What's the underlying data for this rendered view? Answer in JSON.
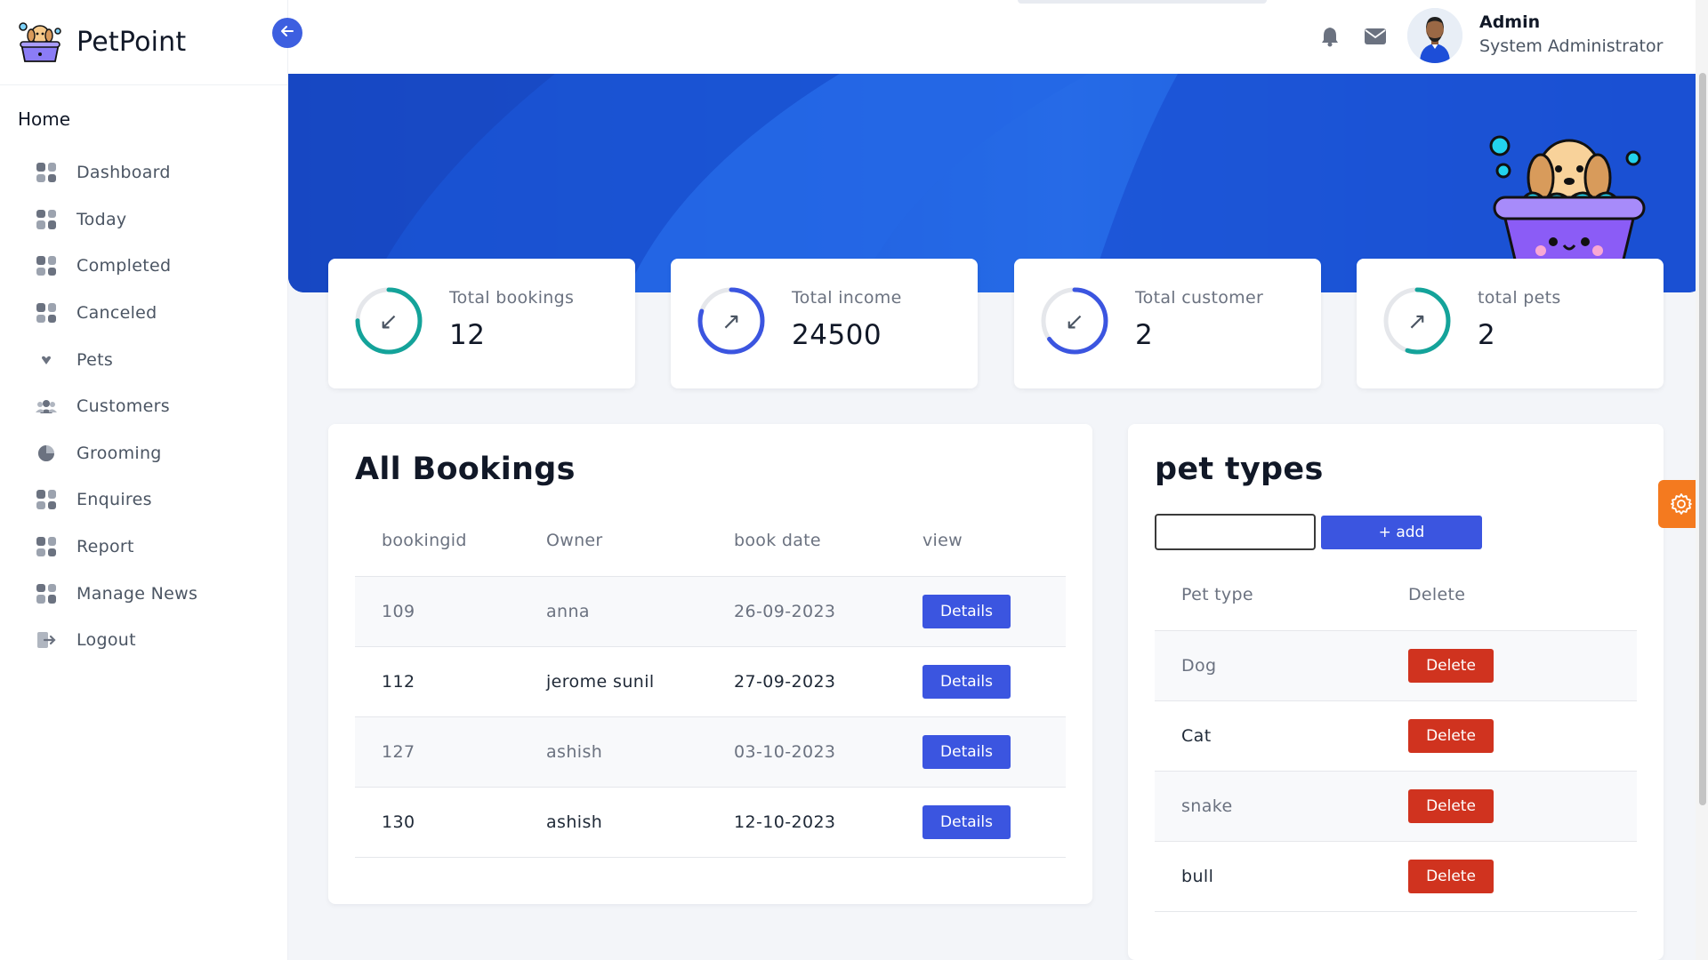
{
  "brand": {
    "name": "PetPoint",
    "logo_icon": "pet-tub-logo-icon"
  },
  "sidebar": {
    "section_title": "Home",
    "items": [
      {
        "label": "Dashboard",
        "icon": "grid-icon"
      },
      {
        "label": "Today",
        "icon": "grid-icon"
      },
      {
        "label": "Completed",
        "icon": "grid-icon"
      },
      {
        "label": "Canceled",
        "icon": "grid-icon"
      },
      {
        "label": "Pets",
        "icon": "heart-icon"
      },
      {
        "label": "Customers",
        "icon": "users-icon"
      },
      {
        "label": "Grooming",
        "icon": "pie-chart-icon"
      },
      {
        "label": "Enquires",
        "icon": "grid-icon"
      },
      {
        "label": "Report",
        "icon": "grid-icon"
      },
      {
        "label": "Manage News",
        "icon": "grid-icon"
      },
      {
        "label": "Logout",
        "icon": "logout-icon"
      }
    ]
  },
  "topbar": {
    "back_icon": "arrow-left-icon",
    "notification_icon": "bell-icon",
    "mail_icon": "mail-icon",
    "user": {
      "name": "Admin",
      "role": "System Administrator"
    }
  },
  "stats": [
    {
      "label": "Total bookings",
      "value": "12",
      "arrow": "↙",
      "ring_color": "#14a39a",
      "ring_fraction": 0.75
    },
    {
      "label": "Total income",
      "value": "24500",
      "arrow": "↗",
      "ring_color": "#3b55e0",
      "ring_fraction": 0.8
    },
    {
      "label": "Total customer",
      "value": "2",
      "arrow": "↙",
      "ring_color": "#3b55e0",
      "ring_fraction": 0.65
    },
    {
      "label": "total pets",
      "value": "2",
      "arrow": "↗",
      "ring_color": "#14a39a",
      "ring_fraction": 0.55
    }
  ],
  "bookings": {
    "title": "All Bookings",
    "columns": [
      "bookingid",
      "Owner",
      "book date",
      "view"
    ],
    "rows": [
      {
        "id": "109",
        "owner": "anna",
        "date": "26-09-2023",
        "action": "Details"
      },
      {
        "id": "112",
        "owner": "jerome sunil",
        "date": "27-09-2023",
        "action": "Details"
      },
      {
        "id": "127",
        "owner": "ashish",
        "date": "03-10-2023",
        "action": "Details"
      },
      {
        "id": "130",
        "owner": "ashish",
        "date": "12-10-2023",
        "action": "Details"
      }
    ]
  },
  "pet_types": {
    "title": "pet types",
    "input_value": "",
    "add_label": "+ add",
    "columns": [
      "Pet type",
      "Delete"
    ],
    "rows": [
      {
        "name": "Dog",
        "action": "Delete"
      },
      {
        "name": "Cat",
        "action": "Delete"
      },
      {
        "name": "snake",
        "action": "Delete"
      },
      {
        "name": "bull",
        "action": "Delete"
      }
    ]
  },
  "colors": {
    "primary": "#3b55e0",
    "danger": "#d0331f",
    "accent_orange": "#f47a1f",
    "hero_blue": "#1e54d6"
  }
}
